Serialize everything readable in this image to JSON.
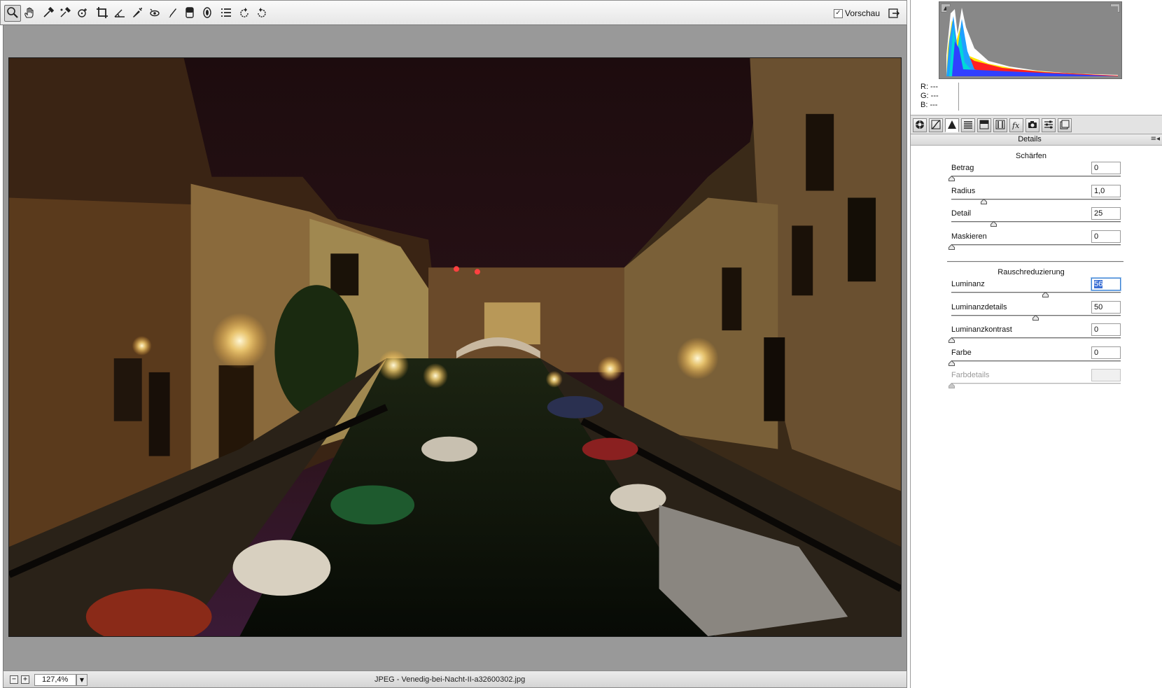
{
  "toolbar": {
    "tools": [
      {
        "name": "zoom-tool",
        "icon": "magnifier-icon",
        "active": true
      },
      {
        "name": "hand-tool",
        "icon": "hand-icon"
      },
      {
        "name": "white-balance-tool",
        "icon": "eyedropper-icon"
      },
      {
        "name": "color-sampler-tool",
        "icon": "color-sampler-icon"
      },
      {
        "name": "target-adjustment-tool",
        "icon": "target-adjust-icon"
      },
      {
        "name": "crop-tool",
        "icon": "crop-icon"
      },
      {
        "name": "straighten-tool",
        "icon": "straighten-icon"
      },
      {
        "name": "spot-removal-tool",
        "icon": "spot-brush-icon"
      },
      {
        "name": "red-eye-tool",
        "icon": "red-eye-icon"
      },
      {
        "name": "adjustment-brush-tool",
        "icon": "brush-icon"
      },
      {
        "name": "graduated-filter-tool",
        "icon": "graduated-filter-icon"
      },
      {
        "name": "radial-filter-tool",
        "icon": "radial-filter-icon"
      },
      {
        "name": "preferences-tool",
        "icon": "list-icon"
      },
      {
        "name": "rotate-left-tool",
        "icon": "rotate-ccw-icon"
      },
      {
        "name": "rotate-right-tool",
        "icon": "rotate-cw-icon"
      }
    ],
    "preview_label": "Vorschau",
    "preview_checked": true
  },
  "statusbar": {
    "zoom_out": "−",
    "zoom_in": "+",
    "zoom_value": "127,4%",
    "file_label": "JPEG - Venedig-bei-Nacht-II-a32600302.jpg"
  },
  "readout": {
    "r": "R:  ---",
    "g": "G:  ---",
    "b": "B:  ---"
  },
  "panel_tabs": [
    {
      "name": "tab-basic",
      "icon": "aperture-icon"
    },
    {
      "name": "tab-tone-curve",
      "icon": "curve-icon"
    },
    {
      "name": "tab-detail",
      "icon": "triangle-detail-icon",
      "active": true
    },
    {
      "name": "tab-hsl",
      "icon": "hsl-bars-icon"
    },
    {
      "name": "tab-split-toning",
      "icon": "split-toning-icon"
    },
    {
      "name": "tab-lens-corrections",
      "icon": "lens-icon"
    },
    {
      "name": "tab-effects",
      "icon": "fx-icon"
    },
    {
      "name": "tab-camera-calibration",
      "icon": "camera-icon"
    },
    {
      "name": "tab-presets",
      "icon": "presets-icon"
    },
    {
      "name": "tab-snapshots",
      "icon": "snapshots-icon"
    }
  ],
  "panel": {
    "title": "Details",
    "menu_icon": "≡◂",
    "sharpen": {
      "title": "Schärfen",
      "sliders": [
        {
          "label": "Betrag",
          "value": "0",
          "fraction": 0.0
        },
        {
          "label": "Radius",
          "value": "1,0",
          "fraction": 0.19
        },
        {
          "label": "Detail",
          "value": "25",
          "fraction": 0.25
        },
        {
          "label": "Maskieren",
          "value": "0",
          "fraction": 0.0
        }
      ]
    },
    "noise": {
      "title": "Rauschreduzierung",
      "sliders": [
        {
          "label": "Luminanz",
          "value": "56",
          "fraction": 0.56,
          "focused": true
        },
        {
          "label": "Luminanzdetails",
          "value": "50",
          "fraction": 0.5
        },
        {
          "label": "Luminanzkontrast",
          "value": "0",
          "fraction": 0.0
        },
        {
          "label": "Farbe",
          "value": "0",
          "fraction": 0.0
        },
        {
          "label": "Farbdetails",
          "value": "",
          "fraction": 0.0,
          "disabled": true
        }
      ]
    }
  },
  "colors": {
    "toolbar_bg": "#e6e6e6",
    "canvas_bg": "#999999",
    "histogram_bg": "#888888",
    "focus_blue": "#3a7fd0"
  }
}
